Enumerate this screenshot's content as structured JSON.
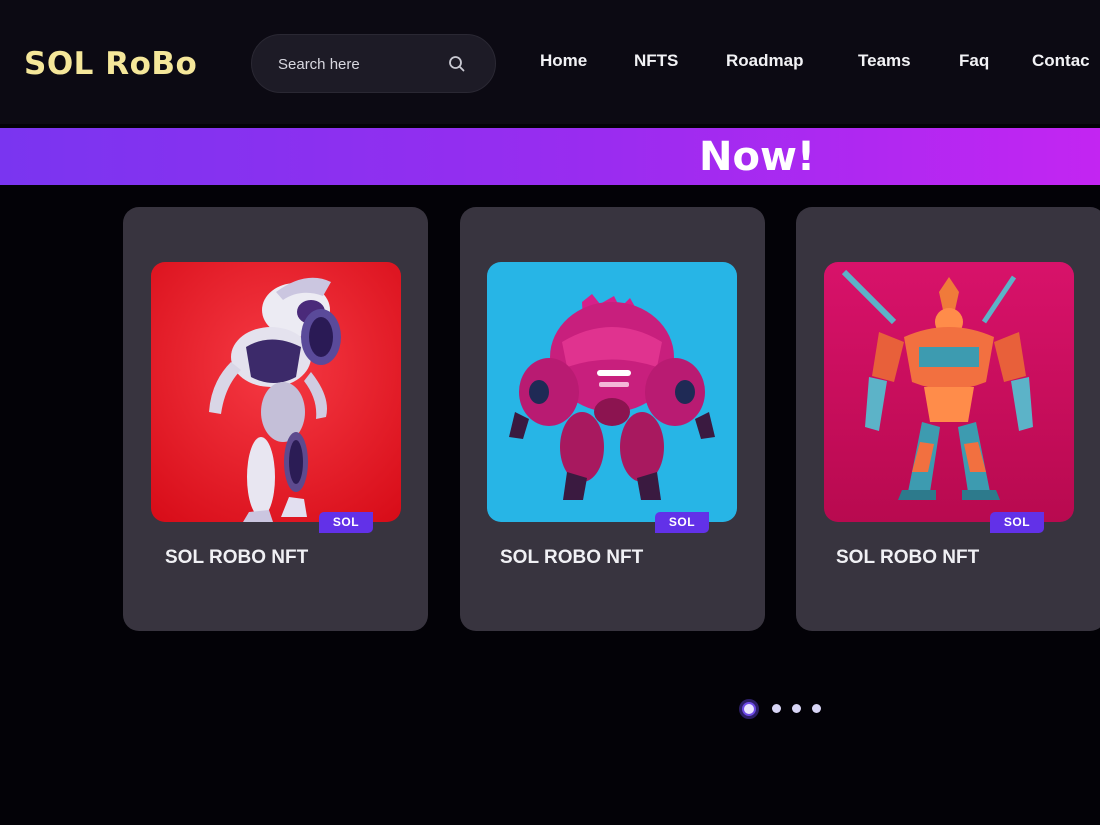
{
  "header": {
    "logo": "SOL RoBo",
    "search": {
      "placeholder": "Search here",
      "value": ""
    },
    "nav": [
      "Home",
      "NFTS",
      "Roadmap",
      "Teams",
      "Faq",
      "Contac"
    ]
  },
  "banner": {
    "text": "Now!"
  },
  "cards": [
    {
      "title": "SOL ROBO NFT",
      "badge": "SOL",
      "background": "#e8121f",
      "robot": "white-purple-robot"
    },
    {
      "title": "SOL ROBO NFT",
      "badge": "SOL",
      "background": "#27b5e6",
      "robot": "magenta-mech-robot"
    },
    {
      "title": "SOL ROBO NFT",
      "badge": "SOL",
      "background": "#d4105c",
      "robot": "orange-gundam-robot"
    }
  ],
  "carousel": {
    "pages": 4,
    "active": 1
  },
  "colors": {
    "accent": "#7a35f0",
    "logo": "#f5e79a",
    "card": "#38343f",
    "badge": "#6231e8"
  }
}
